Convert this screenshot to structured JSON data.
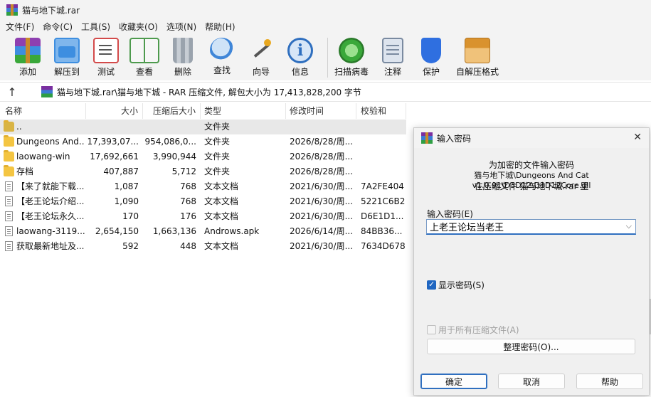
{
  "window": {
    "title": "猫与地下城.rar"
  },
  "menu": [
    "文件(F)",
    "命令(C)",
    "工具(S)",
    "收藏夹(O)",
    "选项(N)",
    "帮助(H)"
  ],
  "toolbar": [
    {
      "label": "添加",
      "icon": "add-archive-icon",
      "color": "#8e3fb0"
    },
    {
      "label": "解压到",
      "icon": "extract-to-icon",
      "color": "#3d8ee0"
    },
    {
      "label": "测试",
      "icon": "test-checklist-icon",
      "color": "#d34a4a"
    },
    {
      "label": "查看",
      "icon": "view-book-icon",
      "color": "#4d9a4d"
    },
    {
      "label": "删除",
      "icon": "trash-icon",
      "color": "#8c96a3"
    },
    {
      "label": "查找",
      "icon": "magnifier-icon",
      "color": "#3f86d8"
    },
    {
      "label": "向导",
      "icon": "wizard-wand-icon",
      "color": "#e9a81f"
    },
    {
      "label": "信息",
      "icon": "info-icon",
      "color": "#2f6fbf"
    },
    {
      "label": "扫描病毒",
      "icon": "virus-scan-icon",
      "color": "#3aa83a"
    },
    {
      "label": "注释",
      "icon": "comment-icon",
      "color": "#7a8aa0"
    },
    {
      "label": "保护",
      "icon": "shield-icon",
      "color": "#2f6fe0"
    },
    {
      "label": "自解压格式",
      "icon": "sfx-box-icon",
      "color": "#d9922e"
    }
  ],
  "path": {
    "text": "猫与地下城.rar\\猫与地下城 - RAR 压缩文件, 解包大小为 17,413,828,200 字节"
  },
  "columns": [
    "名称",
    "大小",
    "压缩后大小",
    "类型",
    "修改时间",
    "校验和"
  ],
  "files": [
    {
      "name": "..",
      "size": "",
      "packed": "",
      "type": "文件夹",
      "modified": "",
      "crc": "",
      "kind": "up"
    },
    {
      "name": "Dungeons And...",
      "size": "17,393,07...",
      "packed": "954,086,0...",
      "type": "文件夹",
      "modified": "2026/8/28/周...",
      "crc": "",
      "kind": "folder"
    },
    {
      "name": "laowang-win",
      "size": "17,692,661",
      "packed": "3,990,944",
      "type": "文件夹",
      "modified": "2026/8/28/周...",
      "crc": "",
      "kind": "folder"
    },
    {
      "name": "存档",
      "size": "407,887",
      "packed": "5,712",
      "type": "文件夹",
      "modified": "2026/8/28/周...",
      "crc": "",
      "kind": "folder"
    },
    {
      "name": "【来了就能下载...",
      "size": "1,087",
      "packed": "768",
      "type": "文本文档",
      "modified": "2021/6/30/周...",
      "crc": "7A2FE404",
      "kind": "doc"
    },
    {
      "name": "【老王论坛介绍...",
      "size": "1,090",
      "packed": "768",
      "type": "文本文档",
      "modified": "2021/6/30/周...",
      "crc": "5221C6B2",
      "kind": "doc"
    },
    {
      "name": "【老王论坛永久...",
      "size": "170",
      "packed": "176",
      "type": "文本文档",
      "modified": "2021/6/30/周...",
      "crc": "D6E1D1...",
      "kind": "doc"
    },
    {
      "name": "laowang-3119...",
      "size": "2,654,150",
      "packed": "1,663,136",
      "type": "Androws.apk",
      "modified": "2026/6/14/周...",
      "crc": "84BB36...",
      "kind": "doc"
    },
    {
      "name": "获取最新地址及...",
      "size": "592",
      "packed": "448",
      "type": "文本文档",
      "modified": "2021/6/30/周...",
      "crc": "7634D678",
      "kind": "doc"
    }
  ],
  "dialog": {
    "title": "输入密码",
    "line1": "为加密的文件输入密码",
    "line2": "猫与地下城\\Dungeons And Cat v1.0.91\\D3D12\\D3D12Core.dll",
    "line3": "在压缩文件 猫与地下城.rar 里",
    "password_label": "输入密码(E)",
    "password_value": "上老王论坛当老王",
    "show_password": "显示密码(S)",
    "use_all": "用于所有压缩文件(A)",
    "organize": "整理密码(O)...",
    "ok": "确定",
    "cancel": "取消",
    "help": "帮助"
  }
}
